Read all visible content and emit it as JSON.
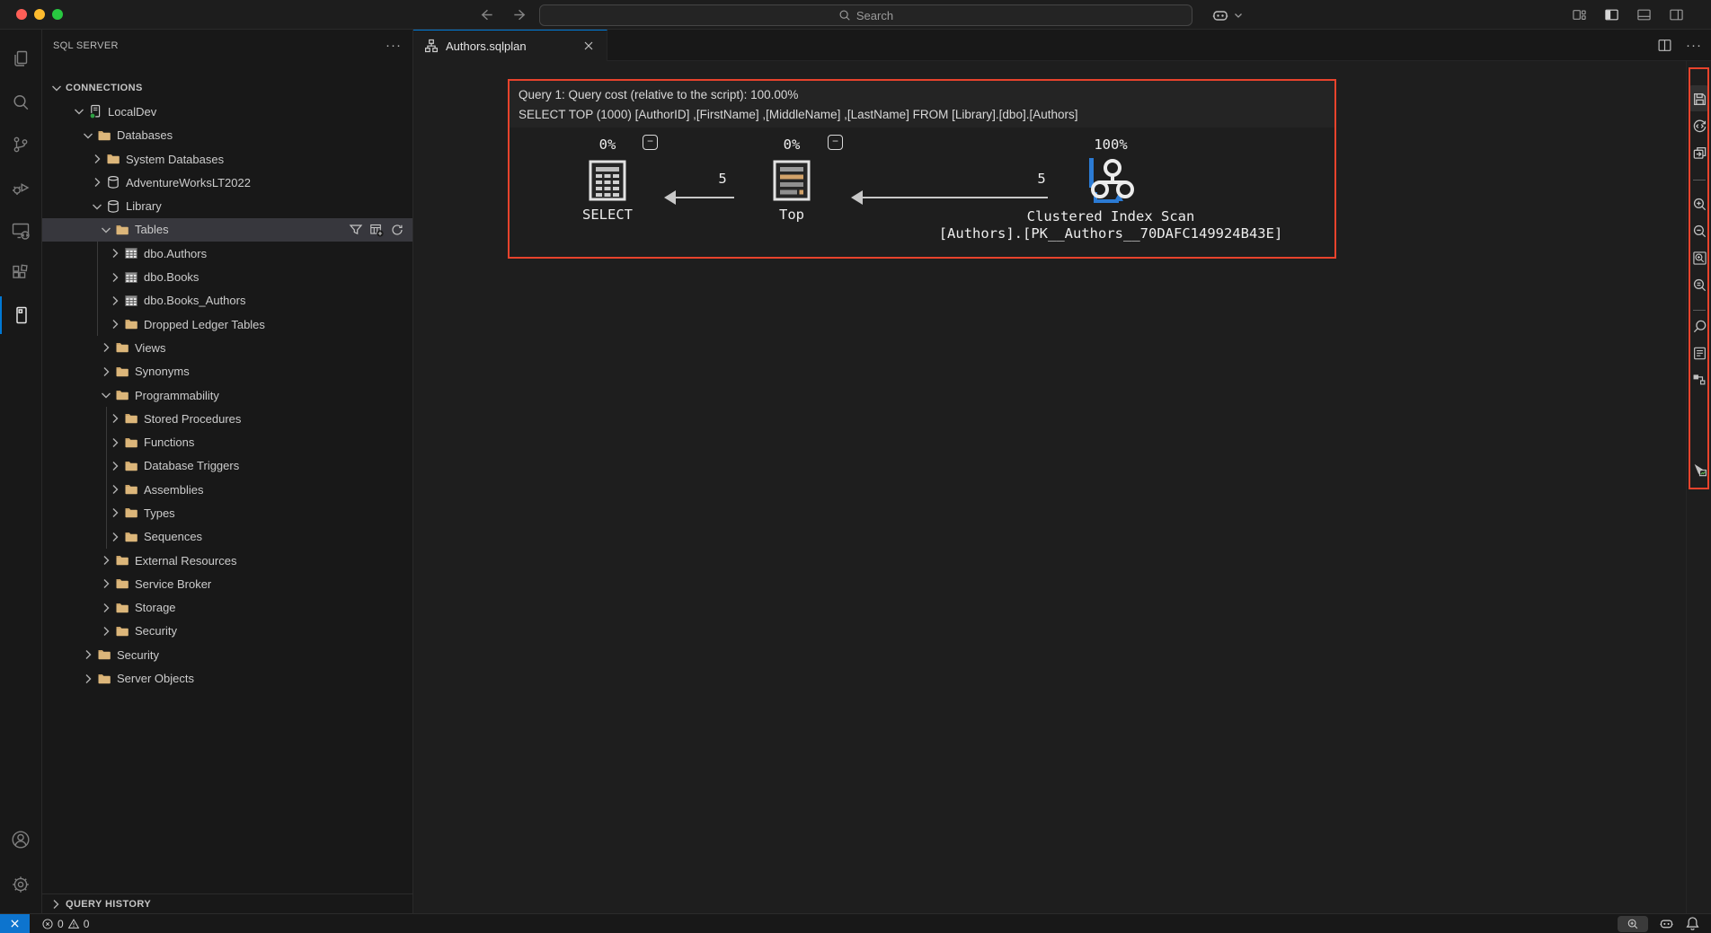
{
  "window": {
    "traffic_lights": [
      "close",
      "minimize",
      "maximize"
    ],
    "search": {
      "placeholder": "Search"
    }
  },
  "titlebar": {
    "right_icons": [
      {
        "icon": "customize-layout-icon",
        "label": "Customize Layout"
      },
      {
        "icon": "toggle-primary-sidebar-icon",
        "label": "Toggle Primary Side Bar",
        "active": true
      },
      {
        "icon": "toggle-panel-icon",
        "label": "Toggle Panel"
      },
      {
        "icon": "toggle-secondary-sidebar-icon",
        "label": "Toggle Secondary Side Bar"
      }
    ]
  },
  "activity_bar": {
    "top": [
      {
        "icon": "explorer-icon",
        "label": "Explorer"
      },
      {
        "icon": "search-icon",
        "label": "Search"
      },
      {
        "icon": "source-control-icon",
        "label": "Source Control"
      },
      {
        "icon": "run-debug-icon",
        "label": "Run and Debug"
      },
      {
        "icon": "remote-explorer-icon",
        "label": "Remote Explorer"
      },
      {
        "icon": "extensions-icon",
        "label": "Extensions"
      },
      {
        "icon": "sql-server-icon",
        "label": "SQL Server",
        "active": true
      }
    ],
    "bottom": [
      {
        "icon": "accounts-icon",
        "label": "Accounts"
      },
      {
        "icon": "settings-gear-icon",
        "label": "Manage"
      }
    ]
  },
  "sidebar": {
    "title": "SQL SERVER",
    "more_label": "···",
    "tree": [
      {
        "label": "CONNECTIONS",
        "level": 0,
        "chevron": "down",
        "icon": null,
        "header": true
      },
      {
        "label": "LocalDev",
        "level": 1,
        "chevron": "down",
        "icon": "server-icon"
      },
      {
        "label": "Databases",
        "level": 2,
        "chevron": "down",
        "icon": "folder-icon"
      },
      {
        "label": "System Databases",
        "level": 3,
        "chevron": "right",
        "icon": "folder-icon"
      },
      {
        "label": "AdventureWorksLT2022",
        "level": 3,
        "chevron": "right",
        "icon": "database-icon"
      },
      {
        "label": "Library",
        "level": 3,
        "chevron": "down",
        "icon": "database-icon"
      },
      {
        "label": "Tables",
        "level": 4,
        "chevron": "down",
        "icon": "folder-icon",
        "selected": true,
        "actions": [
          {
            "icon": "filter-icon",
            "label": "Filter"
          },
          {
            "icon": "new-table-icon",
            "label": "New Table"
          },
          {
            "icon": "refresh-icon",
            "label": "Refresh"
          }
        ]
      },
      {
        "label": "dbo.Authors",
        "level": 5,
        "chevron": "right",
        "icon": "table-icon"
      },
      {
        "label": "dbo.Books",
        "level": 5,
        "chevron": "right",
        "icon": "table-icon"
      },
      {
        "label": "dbo.Books_Authors",
        "level": 5,
        "chevron": "right",
        "icon": "table-icon"
      },
      {
        "label": "Dropped Ledger Tables",
        "level": 5,
        "chevron": "right",
        "icon": "folder-icon"
      },
      {
        "label": "Views",
        "level": 4,
        "chevron": "right",
        "icon": "folder-icon"
      },
      {
        "label": "Synonyms",
        "level": 4,
        "chevron": "right",
        "icon": "folder-icon"
      },
      {
        "label": "Programmability",
        "level": 4,
        "chevron": "down",
        "icon": "folder-icon"
      },
      {
        "label": "Stored Procedures",
        "level": 5,
        "chevron": "right",
        "icon": "folder-icon"
      },
      {
        "label": "Functions",
        "level": 5,
        "chevron": "right",
        "icon": "folder-icon"
      },
      {
        "label": "Database Triggers",
        "level": 5,
        "chevron": "right",
        "icon": "folder-icon"
      },
      {
        "label": "Assemblies",
        "level": 5,
        "chevron": "right",
        "icon": "folder-icon"
      },
      {
        "label": "Types",
        "level": 5,
        "chevron": "right",
        "icon": "folder-icon"
      },
      {
        "label": "Sequences",
        "level": 5,
        "chevron": "right",
        "icon": "folder-icon"
      },
      {
        "label": "External Resources",
        "level": 4,
        "chevron": "right",
        "icon": "folder-icon"
      },
      {
        "label": "Service Broker",
        "level": 4,
        "chevron": "right",
        "icon": "folder-icon"
      },
      {
        "label": "Storage",
        "level": 4,
        "chevron": "right",
        "icon": "folder-icon"
      },
      {
        "label": "Security",
        "level": 4,
        "chevron": "right",
        "icon": "folder-icon"
      },
      {
        "label": "Security",
        "level": 2,
        "chevron": "right",
        "icon": "folder-icon"
      },
      {
        "label": "Server Objects",
        "level": 2,
        "chevron": "right",
        "icon": "folder-icon"
      }
    ],
    "query_history": {
      "label": "QUERY HISTORY"
    }
  },
  "editor": {
    "tab": {
      "label": "Authors.sqlplan"
    },
    "more_label": "···",
    "plan": {
      "header": {
        "line1": "Query 1: Query cost (relative to the script): 100.00%",
        "line2": "SELECT TOP (1000) [AuthorID] ,[FirstName] ,[MiddleName] ,[LastName] FROM [Library].[dbo].[Authors]"
      },
      "collapse_glyph": "−",
      "nodes": [
        {
          "cost": "0%",
          "label": "SELECT"
        },
        {
          "cost": "0%",
          "label": "Top"
        },
        {
          "cost": "100%",
          "label": "Clustered Index Scan",
          "sublabel": "[Authors].[PK__Authors__70DAFC149924B43E]"
        }
      ],
      "edges": [
        {
          "rows": "5"
        },
        {
          "rows": "5"
        }
      ]
    }
  },
  "plan_toolbar": {
    "groups": [
      [
        {
          "icon": "save-plan-icon",
          "label": "Save Plan"
        },
        {
          "icon": "show-query-xml-icon",
          "label": "Show Query XML"
        },
        {
          "icon": "open-query-icon",
          "label": "Open Query"
        }
      ],
      [
        {
          "icon": "zoom-in-icon",
          "label": "Zoom In"
        },
        {
          "icon": "zoom-out-icon",
          "label": "Zoom Out"
        },
        {
          "icon": "zoom-to-fit-icon",
          "label": "Zoom to Fit"
        },
        {
          "icon": "custom-zoom-icon",
          "label": "Custom Zoom"
        }
      ],
      [
        {
          "icon": "find-node-icon",
          "label": "Find Node"
        },
        {
          "icon": "properties-icon",
          "label": "Properties"
        },
        {
          "icon": "highlight-expensive-operation-icon",
          "label": "Highlight Expensive Operation"
        }
      ],
      [
        {
          "icon": "actual-plan-icon",
          "label": "Toggle Actual Plan"
        }
      ]
    ]
  },
  "status_bar": {
    "errors": "0",
    "warnings": "0",
    "right_icons": [
      {
        "icon": "status-zoom-icon",
        "label": "Zoom",
        "boxed": true
      },
      {
        "icon": "copilot-icon",
        "label": "Copilot"
      },
      {
        "icon": "bell-icon",
        "label": "Notifications"
      }
    ]
  },
  "colors": {
    "accent_blue": "#0078d4",
    "annotation_red": "#e8432c",
    "folder_tan": "#dcb67a",
    "remote_blue": "#0d74ce",
    "connection_green": "#2ea043"
  }
}
